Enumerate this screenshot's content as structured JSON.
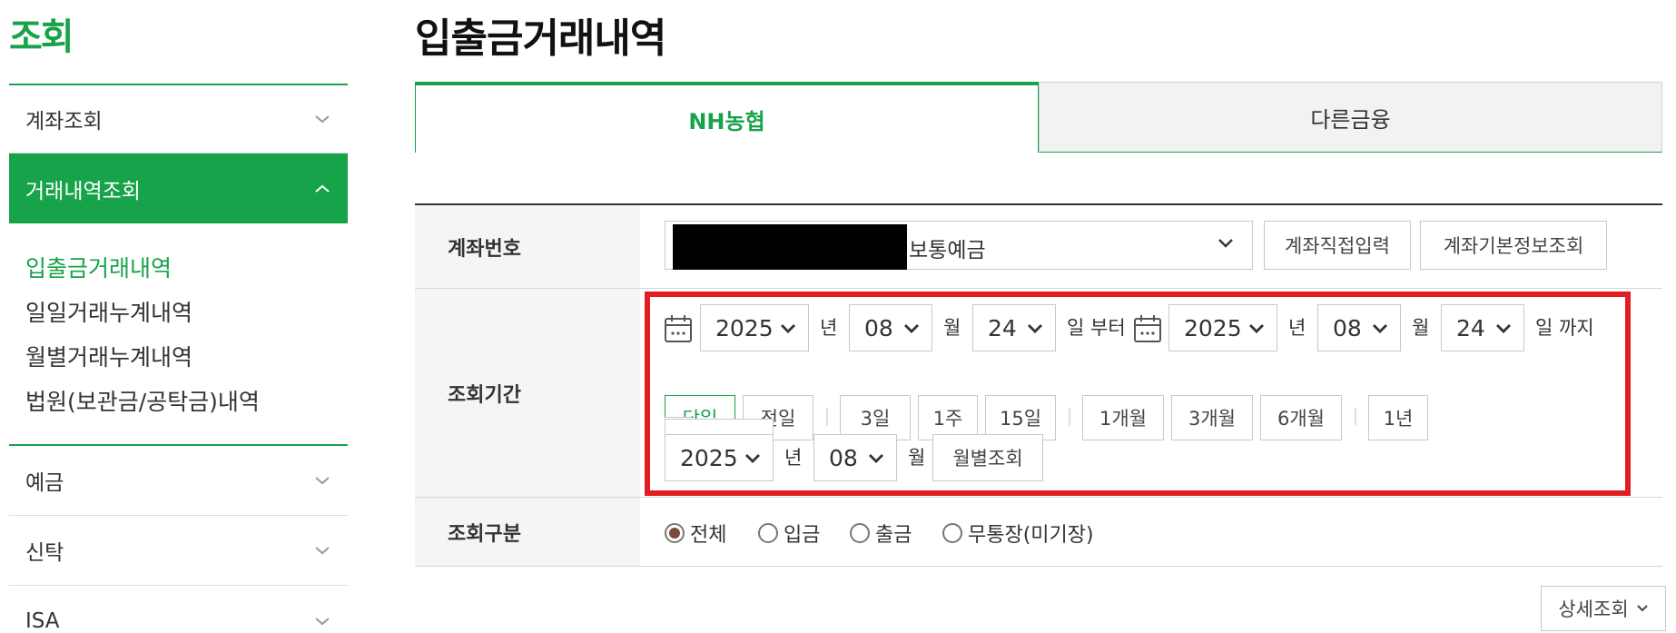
{
  "sidebar": {
    "title": "조회",
    "items": [
      {
        "label": "계좌조회"
      },
      {
        "label": "거래내역조회"
      }
    ],
    "sub_items": [
      {
        "label": "입출금거래내역"
      },
      {
        "label": "일일거래누계내역"
      },
      {
        "label": "월별거래누계내역"
      },
      {
        "label": "법원(보관금/공탁금)내역"
      }
    ],
    "bottom_items": [
      {
        "label": "예금"
      },
      {
        "label": "신탁"
      },
      {
        "label": "ISA"
      }
    ]
  },
  "main": {
    "title": "입출금거래내역",
    "tabs": [
      {
        "label": "NH농협",
        "active": true
      },
      {
        "label": "다른금융",
        "active": false
      }
    ]
  },
  "form": {
    "account": {
      "label": "계좌번호",
      "selected_suffix": "보통예금",
      "btn_direct": "계좌직접입력",
      "btn_info": "계좌기본정보조회"
    },
    "period": {
      "label": "조회기간",
      "from_year": "2025",
      "from_month": "08",
      "from_day": "24",
      "to_year": "2025",
      "to_month": "08",
      "to_day": "24",
      "unit_year": "년",
      "unit_month": "월",
      "unit_day_from": "일 부터",
      "unit_day_to": "일 까지",
      "quick": [
        "당일",
        "전일",
        "3일",
        "1주",
        "15일",
        "1개월",
        "3개월",
        "6개월",
        "1년"
      ],
      "monthly_year": "2025",
      "monthly_month": "08",
      "monthly_btn": "월별조회"
    },
    "type": {
      "label": "조회구분",
      "options": [
        "전체",
        "입금",
        "출금",
        "무통장(미기장)"
      ],
      "selected": "전체"
    }
  },
  "detail_button": "상세조회",
  "colors": {
    "brand_green": "#17a34a",
    "highlight_red": "#e11d22"
  }
}
